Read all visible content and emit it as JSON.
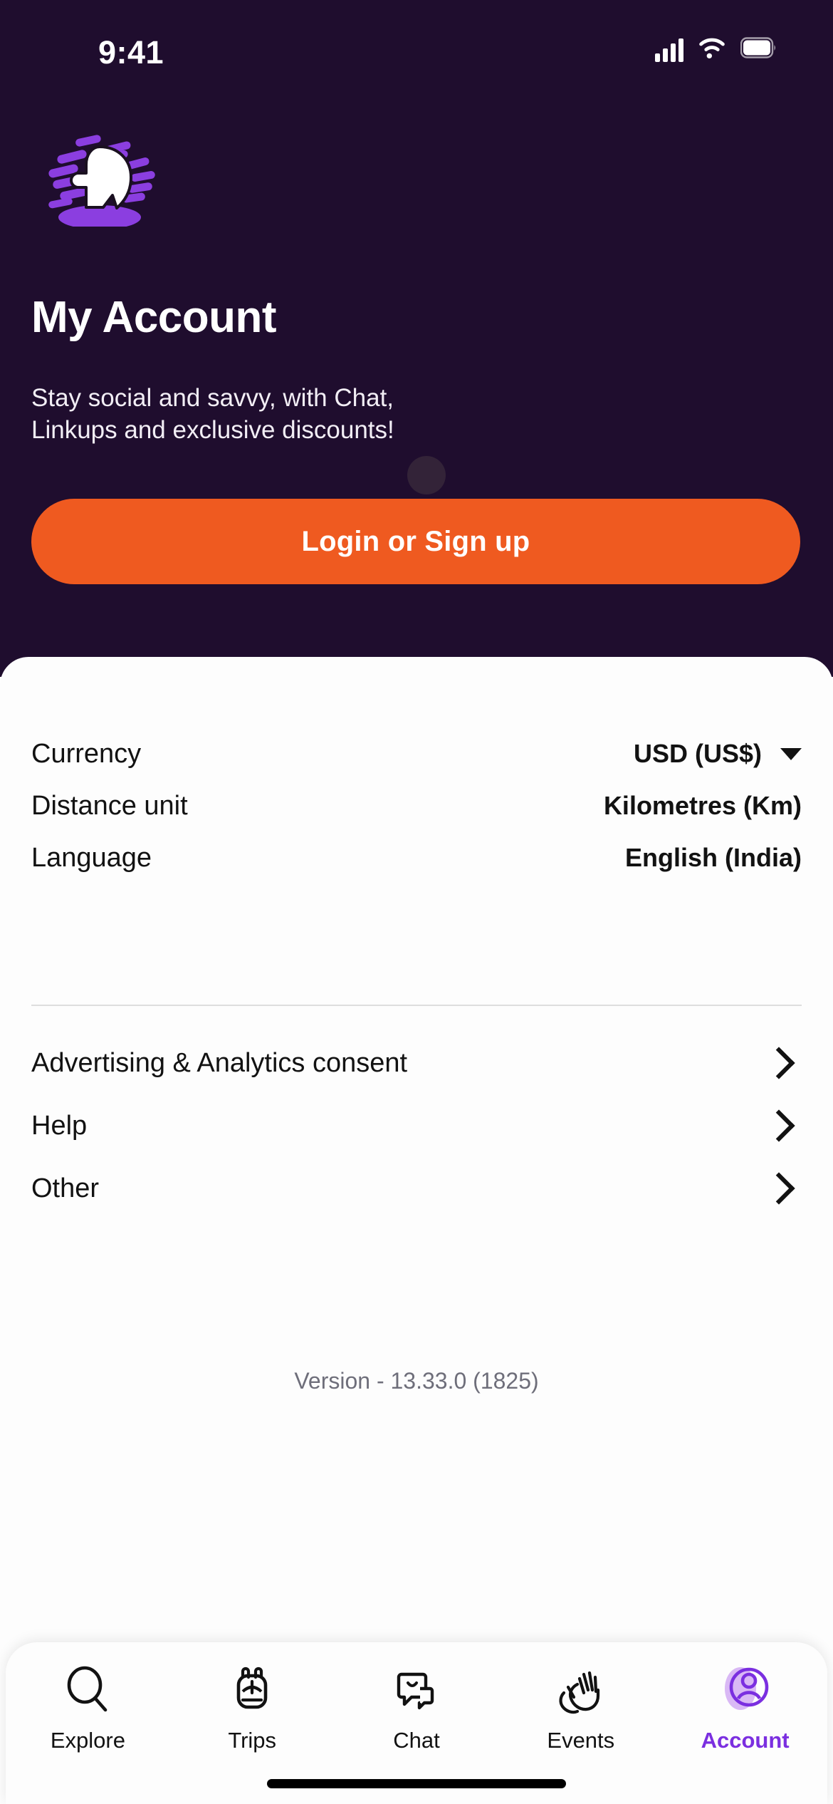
{
  "status_bar": {
    "time": "9:41",
    "cellular_icon": "cellular-signal-icon",
    "wifi_icon": "wifi-icon",
    "battery_icon": "battery-icon"
  },
  "hero": {
    "logo_icon": "app-logo-head-icon",
    "title": "My Account",
    "subtitle": "Stay social and savvy, with Chat, Linkups and exclusive discounts!",
    "cta_label": "Login or Sign up",
    "background_color": "#1F0D2E",
    "cta_color": "#EF5A20",
    "accent_purple": "#8B3EE0"
  },
  "settings": [
    {
      "label": "Currency",
      "value": "USD (US$)",
      "has_caret": true
    },
    {
      "label": "Distance unit",
      "value": "Kilometres (Km)",
      "has_caret": false
    },
    {
      "label": "Language",
      "value": "English (India)",
      "has_caret": false
    }
  ],
  "nav_items": [
    {
      "label": "Advertising & Analytics consent",
      "chevron": "chevron-right-icon"
    },
    {
      "label": "Help",
      "chevron": "chevron-right-icon"
    },
    {
      "label": "Other",
      "chevron": "chevron-right-icon"
    }
  ],
  "footer": {
    "version": "Version - 13.33.0 (1825)"
  },
  "tab_bar": {
    "active_color": "#7B2FE0",
    "items": [
      {
        "label": "Explore",
        "icon": "search-icon",
        "active": false
      },
      {
        "label": "Trips",
        "icon": "backpack-icon",
        "active": false
      },
      {
        "label": "Chat",
        "icon": "chat-bubbles-icon",
        "active": false
      },
      {
        "label": "Events",
        "icon": "waving-hands-icon",
        "active": false
      },
      {
        "label": "Account",
        "icon": "person-account-icon",
        "active": true
      }
    ]
  }
}
